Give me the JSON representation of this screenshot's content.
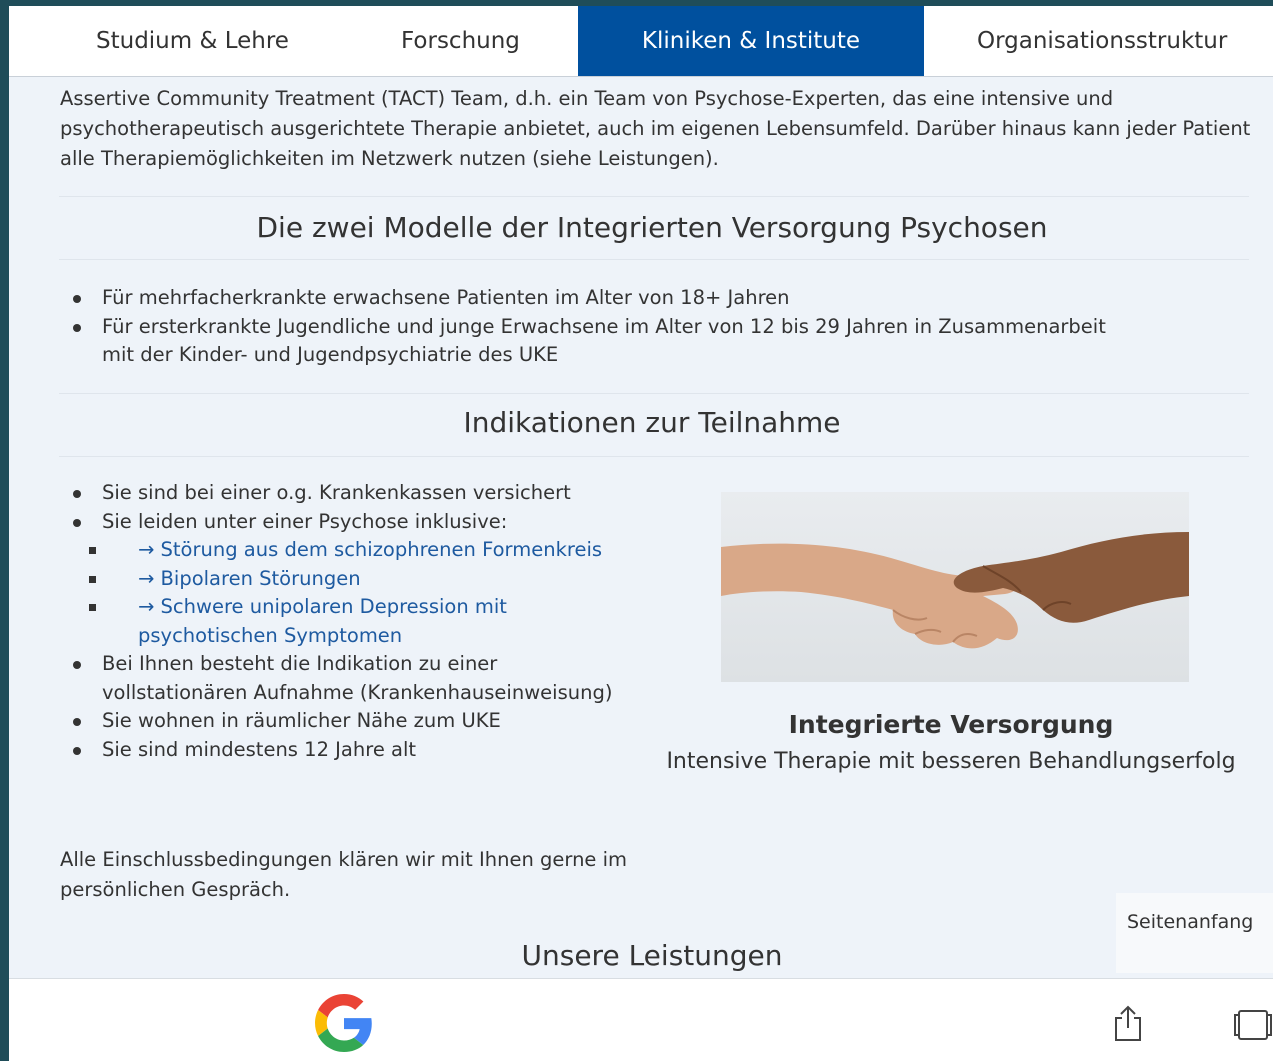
{
  "nav": {
    "items": [
      {
        "label": "Studium & Lehre"
      },
      {
        "label": "Forschung"
      },
      {
        "label": "Kliniken & Institute"
      },
      {
        "label": "Organisationsstruktur"
      }
    ],
    "active_index": 2
  },
  "intro": {
    "text": "Assertive Community Treatment (TACT) Team, d.h. ein Team von Psychose-Experten, das eine intensive und psychotherapeutisch ausgerichtete Therapie anbietet, auch im eigenen Lebensumfeld. Darüber hinaus kann jeder Patient alle Therapiemöglichkeiten im Netzwerk nutzen (siehe Leistungen)."
  },
  "models": {
    "heading": "Die zwei Modelle der Integrierten Versorgung Psychosen",
    "items": [
      "Für mehrfacherkrankte erwachsene Patienten im Alter von 18+ Jahren",
      "Für ersterkrankte Jugendliche und junge Erwachsene im Alter von 12 bis 29 Jahren in Zusammenarbeit mit der Kinder- und Jugendpsychiatrie des UKE"
    ]
  },
  "indications": {
    "heading": "Indikationen zur Teilnahme",
    "item1": "Sie sind bei einer o.g. Krankenkassen versichert",
    "item2": "Sie leiden unter einer Psychose inklusive:",
    "sub_links": [
      "→ Störung aus dem schizophrenen Formenkreis",
      "→ Bipolaren Störungen",
      "→ Schwere unipolaren Depression mit psychotischen Symptomen"
    ],
    "item3": "Bei Ihnen besteht die Indikation zu einer vollstationären Aufnahme (Krankenhauseinweisung)",
    "item4": "Sie wohnen in räumlicher Nähe zum UKE",
    "item5": "Sie sind mindestens 12 Jahre alt",
    "note": "Alle Einschlussbedingungen klären wir mit Ihnen gerne im persönlichen Gespräch."
  },
  "figure": {
    "title": "Integrierte Versorgung",
    "subtitle": "Intensive Therapie mit besseren Behandlungserfolg"
  },
  "services": {
    "heading": "Unsere Leistungen"
  },
  "back_to_top": "Seitenanfang",
  "colors": {
    "nav_active": "#00509e",
    "link": "#1e5aa0",
    "page_bg": "#eef3f9"
  },
  "icons": [
    "google-icon",
    "share-icon",
    "tabs-icon"
  ]
}
